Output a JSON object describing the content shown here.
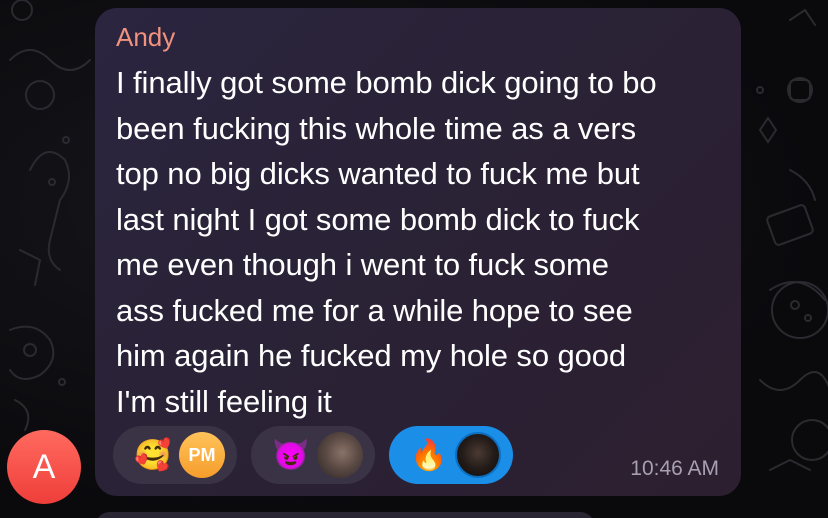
{
  "message": {
    "sender_name": "Andy",
    "text": "I finally got some bomb dick going to bo\nbeen fucking this whole time as a vers\ntop no big dicks wanted to fuck me but\nlast night I got some bomb dick to fuck\nme even though i went to fuck some\nass fucked me for a while hope to see\nhim again he fucked my hole so good\nI'm still feeling it",
    "timestamp": "10:46 AM",
    "sender_avatar_initial": "A",
    "reactions": [
      {
        "emoji": "🥰",
        "reactor_initials": "PM",
        "selected": false
      },
      {
        "emoji": "😈",
        "reactor_initials": "",
        "selected": false
      },
      {
        "emoji": "🔥",
        "reactor_initials": "",
        "selected": true
      }
    ]
  },
  "colors": {
    "sender_name": "#f0927d",
    "bubble": "#2b2540",
    "selected_reaction": "#1b8ee8",
    "avatar": "#ef3e3a"
  }
}
